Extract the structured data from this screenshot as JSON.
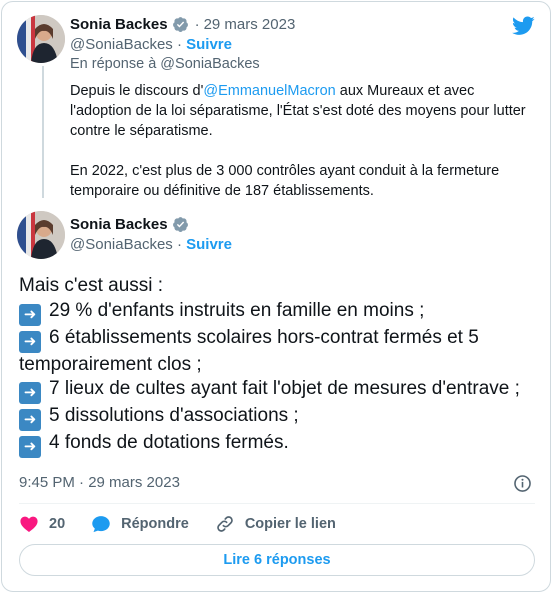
{
  "colors": {
    "link": "#1d9bf0",
    "text": "#0f1419",
    "muted": "#536471",
    "like": "#f91880",
    "verified": "#829aab",
    "border": "#cfd9de"
  },
  "parent_tweet": {
    "author_name": "Sonia Backes",
    "date": "29 mars 2023",
    "handle": "@SoniaBackes",
    "separator": "·",
    "follow_label": "Suivre",
    "reply_prefix": "En réponse à",
    "reply_handle": "@SoniaBackes",
    "paragraph1_before": "Depuis le discours d'",
    "paragraph1_mention": "@EmmanuelMacron",
    "paragraph1_after": " aux Mureaux et avec l'adoption de la loi séparatisme, l'État s'est doté des moyens pour lutter contre le séparatisme.",
    "paragraph2": "En 2022, c'est plus de 3 000 contrôles ayant conduit à la fermeture temporaire ou définitive de 187 établissements."
  },
  "main_tweet": {
    "author_name": "Sonia Backes",
    "handle": "@SoniaBackes",
    "separator": "·",
    "follow_label": "Suivre",
    "intro": "Mais c'est aussi :",
    "bullet_icon": "right-arrow-emoji",
    "bullets": [
      "29 % d'enfants instruits en famille en moins ;",
      "6 établissements scolaires hors-contrat fermés et 5 temporairement clos ;",
      "7 lieux de cultes ayant fait l'objet de mesures d'entrave ;",
      "5 dissolutions d'associations ;",
      "4 fonds de dotations fermés."
    ],
    "timestamp": "9:45 PM · 29 mars 2023"
  },
  "actions": {
    "like_count": "20",
    "reply_label": "Répondre",
    "copy_link_label": "Copier le lien"
  },
  "read_replies_label": "Lire 6 réponses"
}
